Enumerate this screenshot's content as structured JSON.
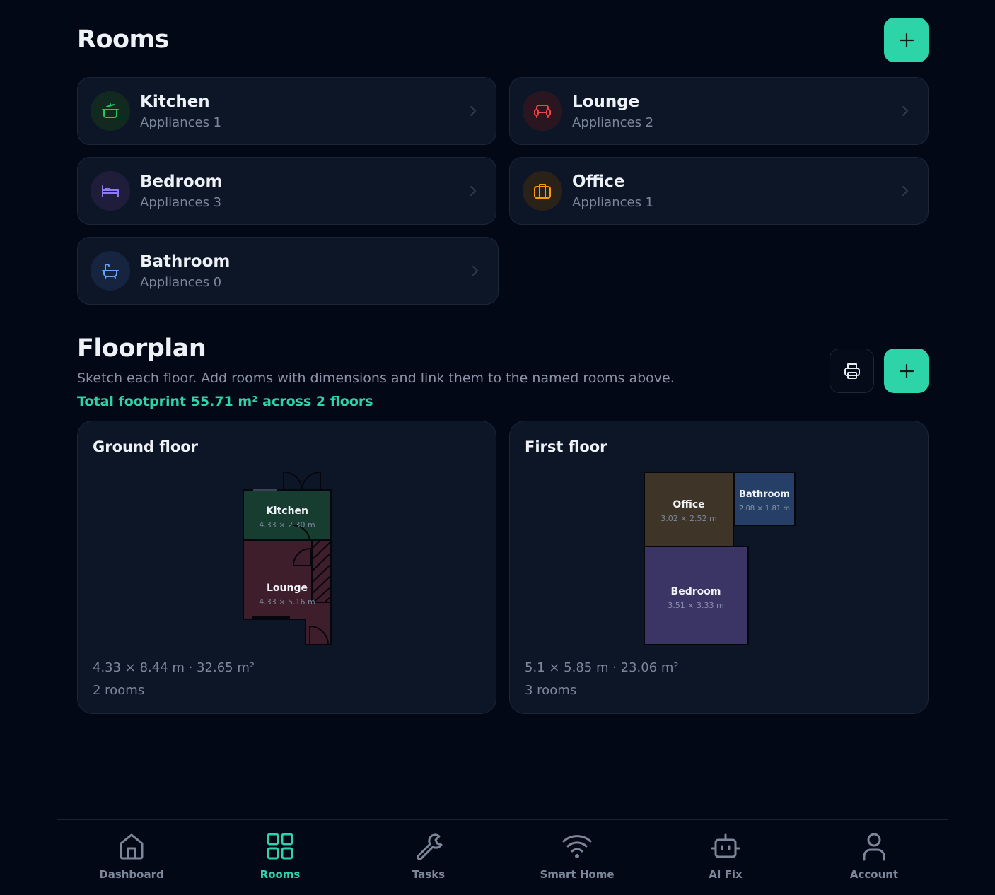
{
  "rooms_section": {
    "title": "Rooms",
    "rooms": [
      {
        "name": "Kitchen",
        "appliances": "Appliances 1",
        "icon": "pot-icon",
        "color": "#22c55e",
        "bg": "#12291f"
      },
      {
        "name": "Lounge",
        "appliances": "Appliances 2",
        "icon": "sofa-icon",
        "color": "#ef4444",
        "bg": "#2a1620"
      },
      {
        "name": "Bedroom",
        "appliances": "Appliances 3",
        "icon": "bed-icon",
        "color": "#8b7cf6",
        "bg": "#1f1d3a"
      },
      {
        "name": "Office",
        "appliances": "Appliances 1",
        "icon": "briefcase-icon",
        "color": "#f59e0b",
        "bg": "#2a2218"
      },
      {
        "name": "Bathroom",
        "appliances": "Appliances 0",
        "icon": "bathtub-icon",
        "color": "#60a5fa",
        "bg": "#172440"
      }
    ]
  },
  "floorplan": {
    "title": "Floorplan",
    "subtitle": "Sketch each floor. Add rooms with dimensions and link them to the named rooms above.",
    "total": "Total footprint 55.71 m² across 2 floors",
    "floors": [
      {
        "title": "Ground floor",
        "dims": "4.33 × 8.44 m · 32.65 m²",
        "count": "2 rooms",
        "rooms": [
          {
            "name": "Kitchen",
            "dims": "4.33 × 2.30 m",
            "color": "#173c30"
          },
          {
            "name": "Lounge",
            "dims": "4.33 × 5.16 m",
            "color": "#3e1e2a"
          }
        ]
      },
      {
        "title": "First floor",
        "dims": "5.1 × 5.85 m · 23.06 m²",
        "count": "3 rooms",
        "rooms": [
          {
            "name": "Office",
            "dims": "3.02 × 2.52 m",
            "color": "#3e3427"
          },
          {
            "name": "Bathroom",
            "dims": "2.08 × 1.81 m",
            "color": "#263f66"
          },
          {
            "name": "Bedroom",
            "dims": "3.51 × 3.33 m",
            "color": "#3b3566"
          }
        ]
      }
    ]
  },
  "nav": {
    "items": [
      {
        "label": "Dashboard",
        "icon": "home-icon"
      },
      {
        "label": "Rooms",
        "icon": "grid-icon"
      },
      {
        "label": "Tasks",
        "icon": "wrench-icon"
      },
      {
        "label": "Smart Home",
        "icon": "wifi-icon"
      },
      {
        "label": "AI Fix",
        "icon": "robot-icon"
      },
      {
        "label": "Account",
        "icon": "user-icon"
      }
    ],
    "active": "Rooms",
    "accent": "#2dd4a7"
  }
}
